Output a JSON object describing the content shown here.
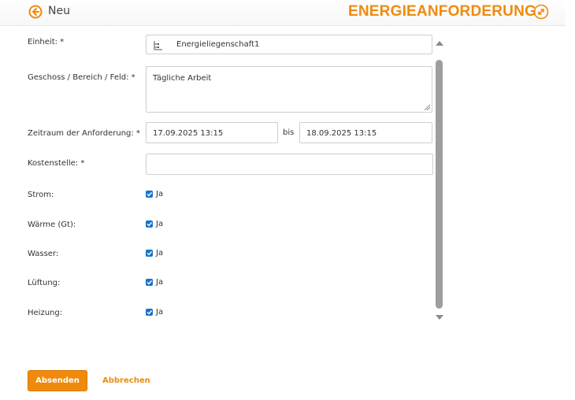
{
  "header": {
    "back_label": "Neu",
    "title": "ENERGIEANFORDERUNG",
    "accent_color": "#f08a0c",
    "back_icon": "arrow-left-circle-icon",
    "expand_icon": "expand-icon"
  },
  "form": {
    "einheit": {
      "label": "Einheit: *",
      "value": "Energieliegenschaft1",
      "icon": "tree-icon"
    },
    "geschoss": {
      "label": "Geschoss / Bereich / Feld: *",
      "value": "Tägliche Arbeit"
    },
    "zeitraum": {
      "label": "Zeitraum der Anforderung: *",
      "from": "17.09.2025 13:15",
      "separator": "bis",
      "to": "18.09.2025 13:15"
    },
    "kostenstelle": {
      "label": "Kostenstelle: *",
      "value": ""
    },
    "checks": [
      {
        "label": "Strom:",
        "value": "Ja",
        "checked": true
      },
      {
        "label": "Wärme (Gt):",
        "value": "Ja",
        "checked": true
      },
      {
        "label": "Wasser:",
        "value": "Ja",
        "checked": true
      },
      {
        "label": "Lüftung:",
        "value": "Ja",
        "checked": true
      },
      {
        "label": "Heizung:",
        "value": "Ja",
        "checked": true
      }
    ]
  },
  "actions": {
    "submit_label": "Absenden",
    "cancel_label": "Abbrechen"
  }
}
